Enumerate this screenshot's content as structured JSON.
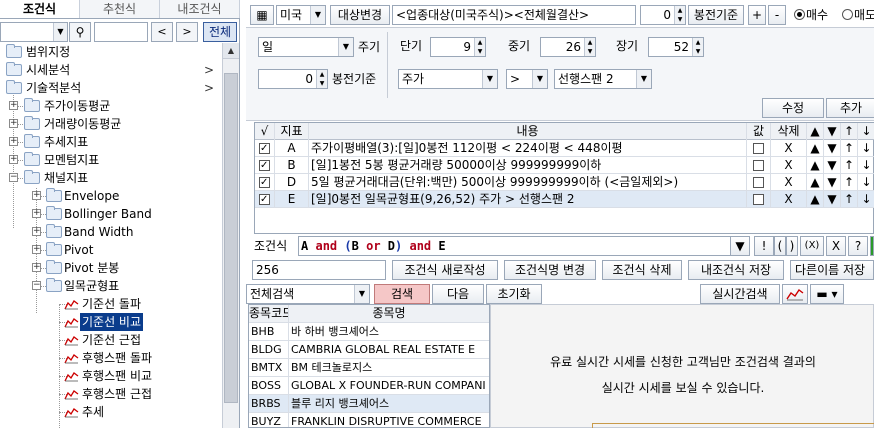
{
  "left": {
    "tabs": [
      "조건식",
      "추천식",
      "내조건식"
    ],
    "nav_prev": "<",
    "nav_next": ">",
    "all_button": "전체",
    "tree": {
      "range": "범위지정",
      "market": "시세분석",
      "technical": "기술적분석",
      "ma": "주가이동평균",
      "volma": "거래량이동평균",
      "trend": "추세지표",
      "momentum": "모멘텀지표",
      "channel": "채널지표",
      "envelope": "Envelope",
      "bollinger": "Bollinger Band",
      "bandwidth": "Band Width",
      "pivot": "Pivot",
      "pivotdist": "Pivot 분봉",
      "ichimoku": "일목균형표",
      "leaf1": "기준선 돌파",
      "leaf2": "기준선 비교",
      "leaf3": "기준선 근접",
      "leaf4": "후행스팬 돌파",
      "leaf5": "후행스팬 비교",
      "leaf6": "후행스팬 근접",
      "leaf7": "추세",
      "arrow": ">"
    }
  },
  "top": {
    "market": "미국",
    "target_btn": "대상변경",
    "target_text": "<업종대상(미국주식)><전체월결산>",
    "bar_value": "0",
    "bar_label": "봉전기준",
    "plus": "+",
    "minus": "-",
    "radio_buy": "매수",
    "radio_sell": "매도"
  },
  "settings": {
    "period": "일",
    "period_label": "주기",
    "bars": "0",
    "bars_label": "봉전기준",
    "short_label": "단기",
    "short_val": "9",
    "mid_label": "중기",
    "mid_val": "26",
    "long_label": "장기",
    "long_val": "52",
    "field1": "주가",
    "operator": ">",
    "field2": "선행스팬 2",
    "edit_btn": "수정",
    "add_btn": "추가"
  },
  "grid": {
    "headers": [
      "√",
      "지표",
      "내용",
      "값",
      "삭제",
      "▲",
      "▼",
      "↑",
      "↓"
    ],
    "rows": [
      {
        "id": "A",
        "content": "주가이평배열(3):[일]0봉전 112이평 < 224이평 < 448이평",
        "del": "X",
        "up": "▲",
        "down": "▼",
        "top": "↑",
        "bottom": "↓"
      },
      {
        "id": "B",
        "content": "[일]1봉전 5봉 평균거래량 50000이상 999999999이하",
        "del": "X",
        "up": "▲",
        "down": "▼",
        "top": "↑",
        "bottom": "↓"
      },
      {
        "id": "D",
        "content": "5일 평균거래대금(단위:백만) 500이상 999999999이하 (<금일제외>)",
        "del": "X",
        "up": "▲",
        "down": "▼",
        "top": "↑",
        "bottom": "↓"
      },
      {
        "id": "E",
        "content": "[일]0봉전 일목균형표(9,26,52) 주가 > 선행스팬 2",
        "del": "X",
        "up": "▲",
        "down": "▼",
        "top": "↑",
        "bottom": "↓"
      }
    ]
  },
  "condition": {
    "label": "조건식",
    "expr": {
      "a": "A",
      "and1": "and",
      "lp": "(",
      "b": "B",
      "or": "or",
      "d": "D",
      "rp": ")",
      "and2": "and",
      "e": "E"
    },
    "tools": [
      "▼",
      "!",
      "(",
      ")",
      "(X)",
      "X",
      "?"
    ]
  },
  "actions": {
    "count": "256",
    "new_btn": "조건식 새로작성",
    "rename_btn": "조건식명 변경",
    "delete_btn": "조건식 삭제",
    "save_btn": "내조건식 저장",
    "saveas_btn": "다른이름 저장"
  },
  "search": {
    "scope": "전체검색",
    "search_btn": "검색",
    "next_btn": "다음",
    "reset_btn": "초기화",
    "realtime_btn": "실시간검색"
  },
  "list": {
    "headers": [
      "종목코드",
      "종목명"
    ],
    "rows": [
      {
        "code": "BHB",
        "name": "바 하버 뱅크셰어스"
      },
      {
        "code": "BLDG",
        "name": "CAMBRIA GLOBAL REAL ESTATE E"
      },
      {
        "code": "BMTX",
        "name": "BM 테크놀로지스"
      },
      {
        "code": "BOSS",
        "name": "GLOBAL X FOUNDER-RUN COMPANI"
      },
      {
        "code": "BRBS",
        "name": "블루 리지 뱅크셰어스"
      },
      {
        "code": "BUYZ",
        "name": "FRANKLIN DISRUPTIVE COMMERCE"
      }
    ]
  },
  "notice": {
    "line1": "유료 실시간 시세를 신청한 고객님만 조건검색 결과의",
    "line2": "실시간 시세를 보실 수 있습니다."
  },
  "colors": {
    "accent": "#0a3c8c",
    "search_btn_bg": "#f5c7c7",
    "operator": "#b0001a",
    "paren": "#1a3aa8"
  }
}
